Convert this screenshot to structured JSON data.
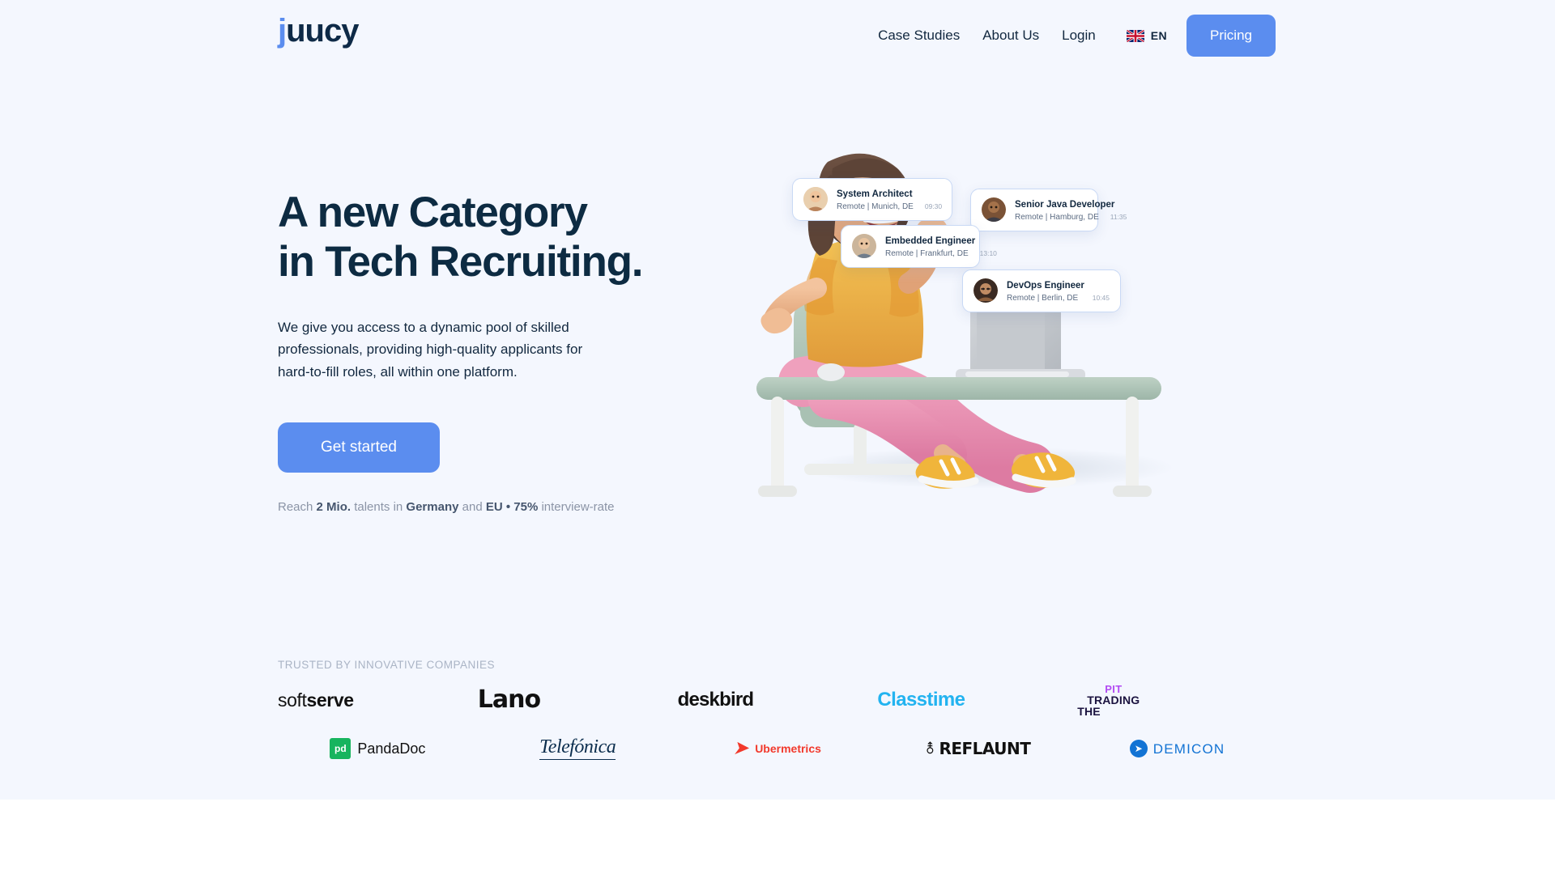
{
  "brand": {
    "logo_text": "juucy",
    "logo_first_letter": "j",
    "logo_rest": "uucy",
    "accent": "#5b8def",
    "dark": "#0d2b42"
  },
  "header": {
    "nav": [
      {
        "label": "Case Studies",
        "name": "nav-case-studies"
      },
      {
        "label": "About Us",
        "name": "nav-about-us"
      },
      {
        "label": "Login",
        "name": "nav-login"
      }
    ],
    "language": {
      "code": "EN",
      "flag": "uk-flag-icon"
    },
    "cta": {
      "label": "Pricing"
    }
  },
  "hero": {
    "title": "A new Category\nin Tech Recruiting.",
    "subtitle": "We give you access to a dynamic pool of skilled\nprofessionals, providing high-quality applicants for\nhard-to-fill roles, all within one platform.",
    "cta_label": "Get started",
    "reach": {
      "prefix": "Reach ",
      "count": "2 Mio.",
      "mid": " talents in ",
      "country": "Germany",
      "and": " and ",
      "region": "EU • 75%",
      "suffix": " interview-rate"
    }
  },
  "job_cards": [
    {
      "role": "System Architect",
      "location": "Remote | Munich, DE",
      "time": "09:30",
      "avatar": "avatar-system-architect"
    },
    {
      "role": "Senior Java Developer",
      "location": "Remote | Hamburg, DE",
      "time": "11:35",
      "avatar": "avatar-senior-java-developer"
    },
    {
      "role": "Embedded Engineer",
      "location": "Remote | Frankfurt, DE",
      "time": "13:10",
      "avatar": "avatar-embedded-engineer"
    },
    {
      "role": "DevOps Engineer",
      "location": "Remote | Berlin, DE",
      "time": "10:45",
      "avatar": "avatar-devops-engineer"
    }
  ],
  "trusted": {
    "label": "TRUSTED BY INNOVATIVE COMPANIES",
    "row1": [
      {
        "name": "softserve",
        "light": "soft",
        "bold": "serve"
      },
      {
        "name": "lano",
        "text": "Lano"
      },
      {
        "name": "deskbird",
        "text": "deskbird"
      },
      {
        "name": "classtime",
        "text": "Classtime"
      },
      {
        "name": "the-trading-pit",
        "pit": "PIT",
        "trading": "TRADING",
        "the": "THE"
      }
    ],
    "row2": [
      {
        "name": "pandadoc",
        "mark": "pd",
        "text": "PandaDoc"
      },
      {
        "name": "telefonica",
        "text": "Telefónica"
      },
      {
        "name": "ubermetrics",
        "text": "Ubermetrics"
      },
      {
        "name": "reflaunt",
        "text": "REFLAUNT"
      },
      {
        "name": "demicon",
        "text": "DEMICON"
      }
    ]
  }
}
